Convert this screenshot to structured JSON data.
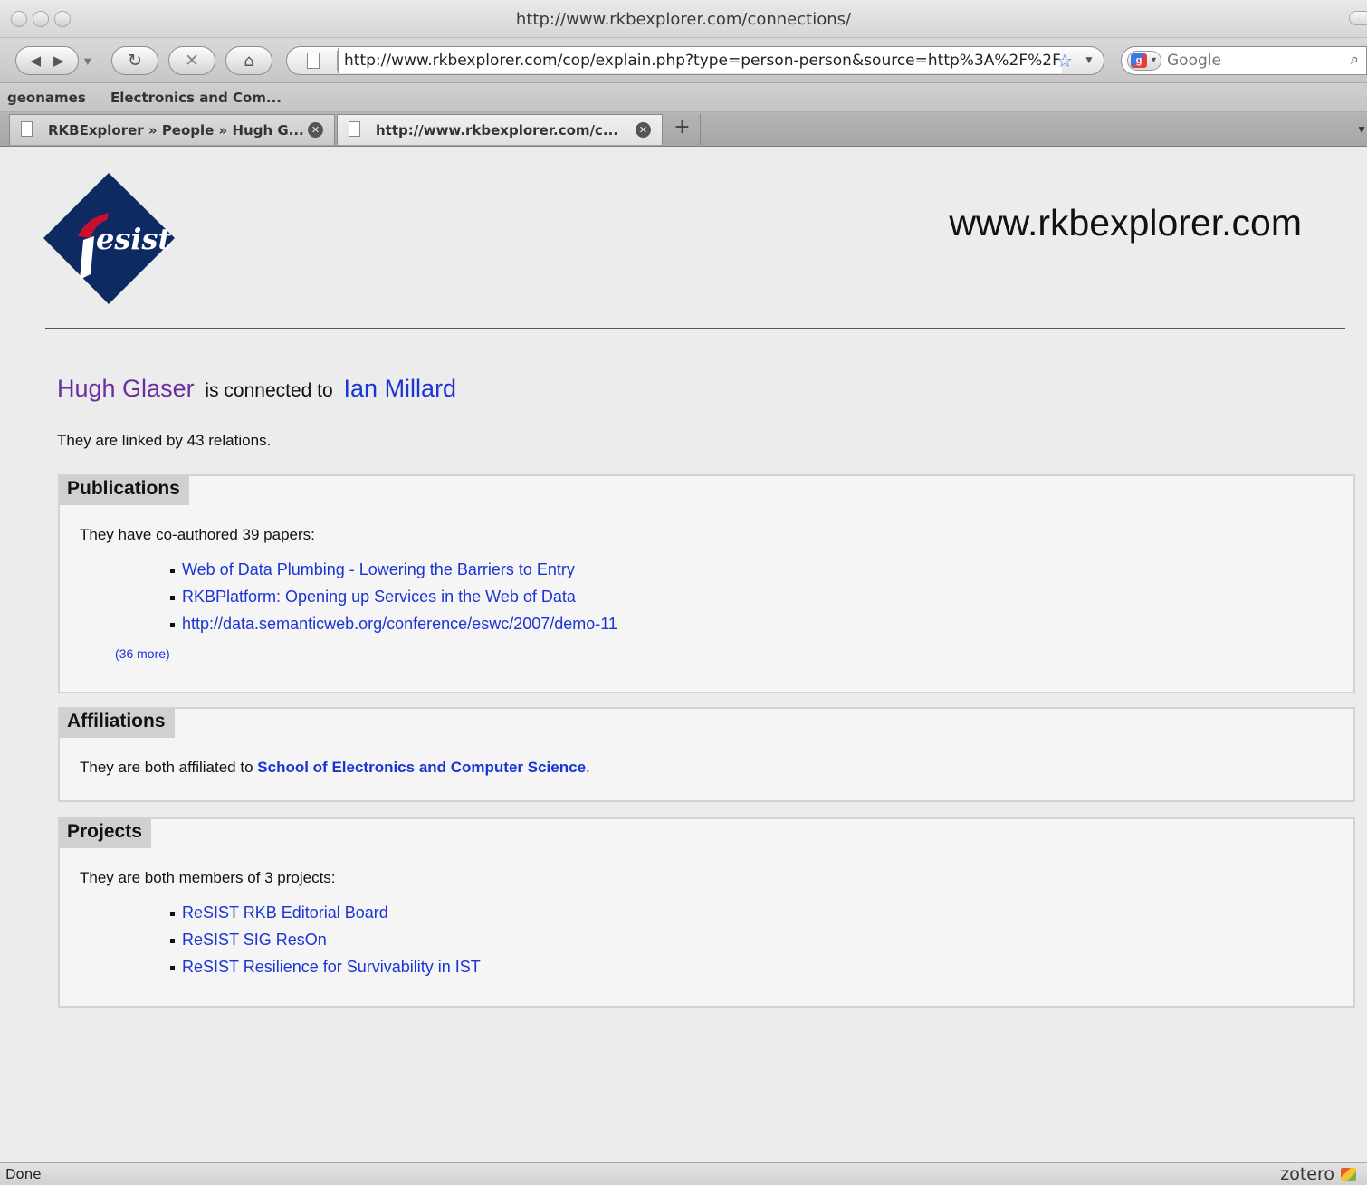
{
  "window": {
    "title": "http://www.rkbexplorer.com/connections/"
  },
  "toolbar": {
    "url": "http://www.rkbexplorer.com/cop/explain.php?type=person-person&source=http%3A%2F%2F",
    "search_placeholder": "Google"
  },
  "bookmarks": [
    {
      "label": "geonames"
    },
    {
      "label": "Electronics and Com..."
    }
  ],
  "tabs": [
    {
      "label": "RKBExplorer » People » Hugh G...",
      "active": false
    },
    {
      "label": "http://www.rkbexplorer.com/c...",
      "active": true
    }
  ],
  "header": {
    "logo_text": "esist",
    "site_title": "www.rkbexplorer.com"
  },
  "connection": {
    "person1": "Hugh Glaser",
    "connector": "is connected to",
    "person2": "Ian Millard",
    "summary": "They are linked by 43 relations."
  },
  "publications": {
    "heading": "Publications",
    "intro": "They have co-authored 39 papers:",
    "items": [
      "Web of Data Plumbing - Lowering the Barriers to Entry",
      "RKBPlatform: Opening up Services in the Web of Data",
      "http://data.semanticweb.org/conference/eswc/2007/demo-11"
    ],
    "more": "(36 more)"
  },
  "affiliations": {
    "heading": "Affiliations",
    "intro": "They are both affiliated to",
    "org": "School of Electronics and Computer Science",
    "suffix": "."
  },
  "projects": {
    "heading": "Projects",
    "intro": "They are both members of 3 projects:",
    "items": [
      "ReSIST RKB Editorial Board",
      "ReSIST SIG ResOn",
      "ReSIST Resilience for Survivability in IST"
    ]
  },
  "status": {
    "text": "Done",
    "addon": "zotero"
  },
  "colors": {
    "link": "#1a34d6",
    "visited": "#6a2e9e",
    "logo_blue": "#0d2a63",
    "logo_red": "#c8102e"
  },
  "icons": [
    "back-icon",
    "forward-icon",
    "reload-icon",
    "stop-icon",
    "home-icon",
    "page-icon",
    "bookmark-star-icon",
    "search-icon",
    "close-icon",
    "new-tab-icon"
  ]
}
